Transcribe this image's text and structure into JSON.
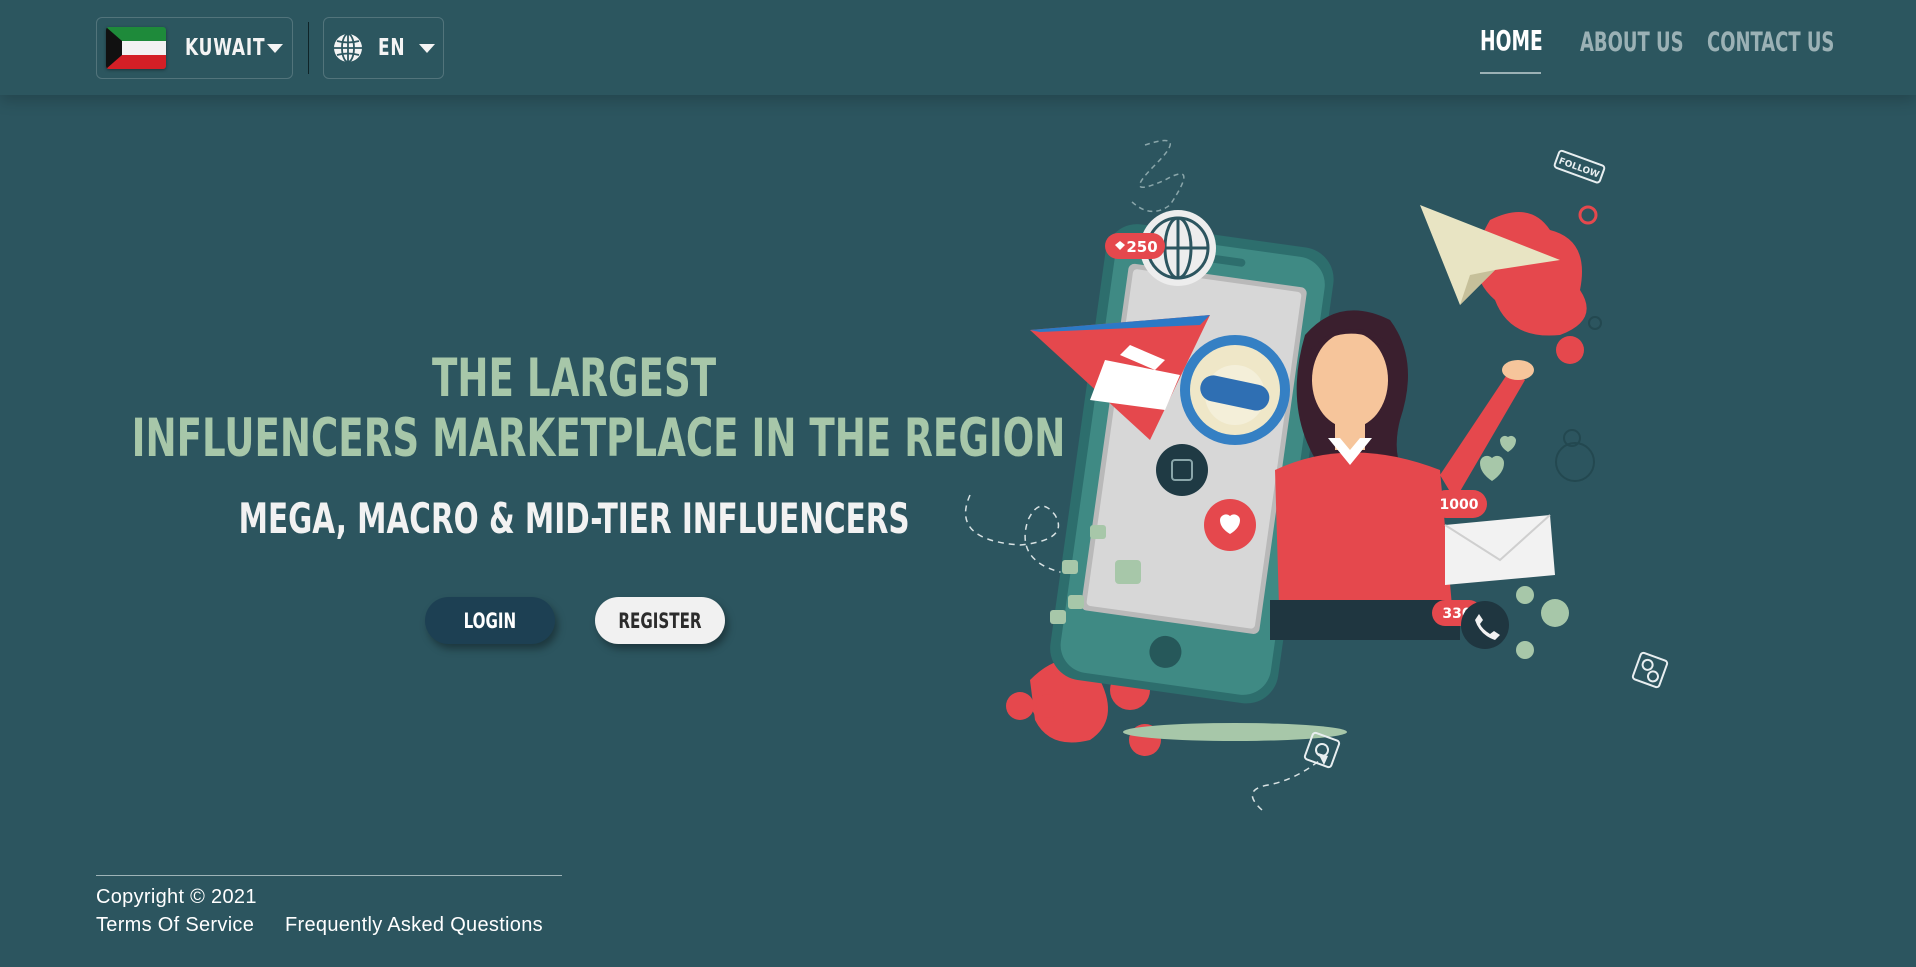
{
  "header": {
    "country": {
      "label": "KUWAIT",
      "flag_icon": "kuwait-flag-icon"
    },
    "language": {
      "label": "EN",
      "icon": "globe-icon"
    },
    "nav": [
      {
        "label": "HOME",
        "active": true
      },
      {
        "label": "ABOUT US",
        "active": false
      },
      {
        "label": "CONTACT US",
        "active": false
      }
    ]
  },
  "hero": {
    "title_line1": "THE LARGEST",
    "title_line2": "INFLUENCERS MARKETPLACE IN THE REGION",
    "subtitle": "MEGA, MACRO & MID-TIER INFLUENCERS",
    "login_label": "LOGIN",
    "register_label": "REGISTER"
  },
  "illustration": {
    "likes_badge": "250",
    "count_badge_1": "1000",
    "count_badge_2": "330",
    "follow_tag": "FOLLOW"
  },
  "footer": {
    "copyright": "Copyright © 2021",
    "terms": "Terms Of Service",
    "faq": "Frequently Asked Questions"
  },
  "colors": {
    "background": "#2c555f",
    "title_green": "#a7c7a9",
    "login_bg": "#1d4053",
    "accent_red": "#e5484d"
  }
}
